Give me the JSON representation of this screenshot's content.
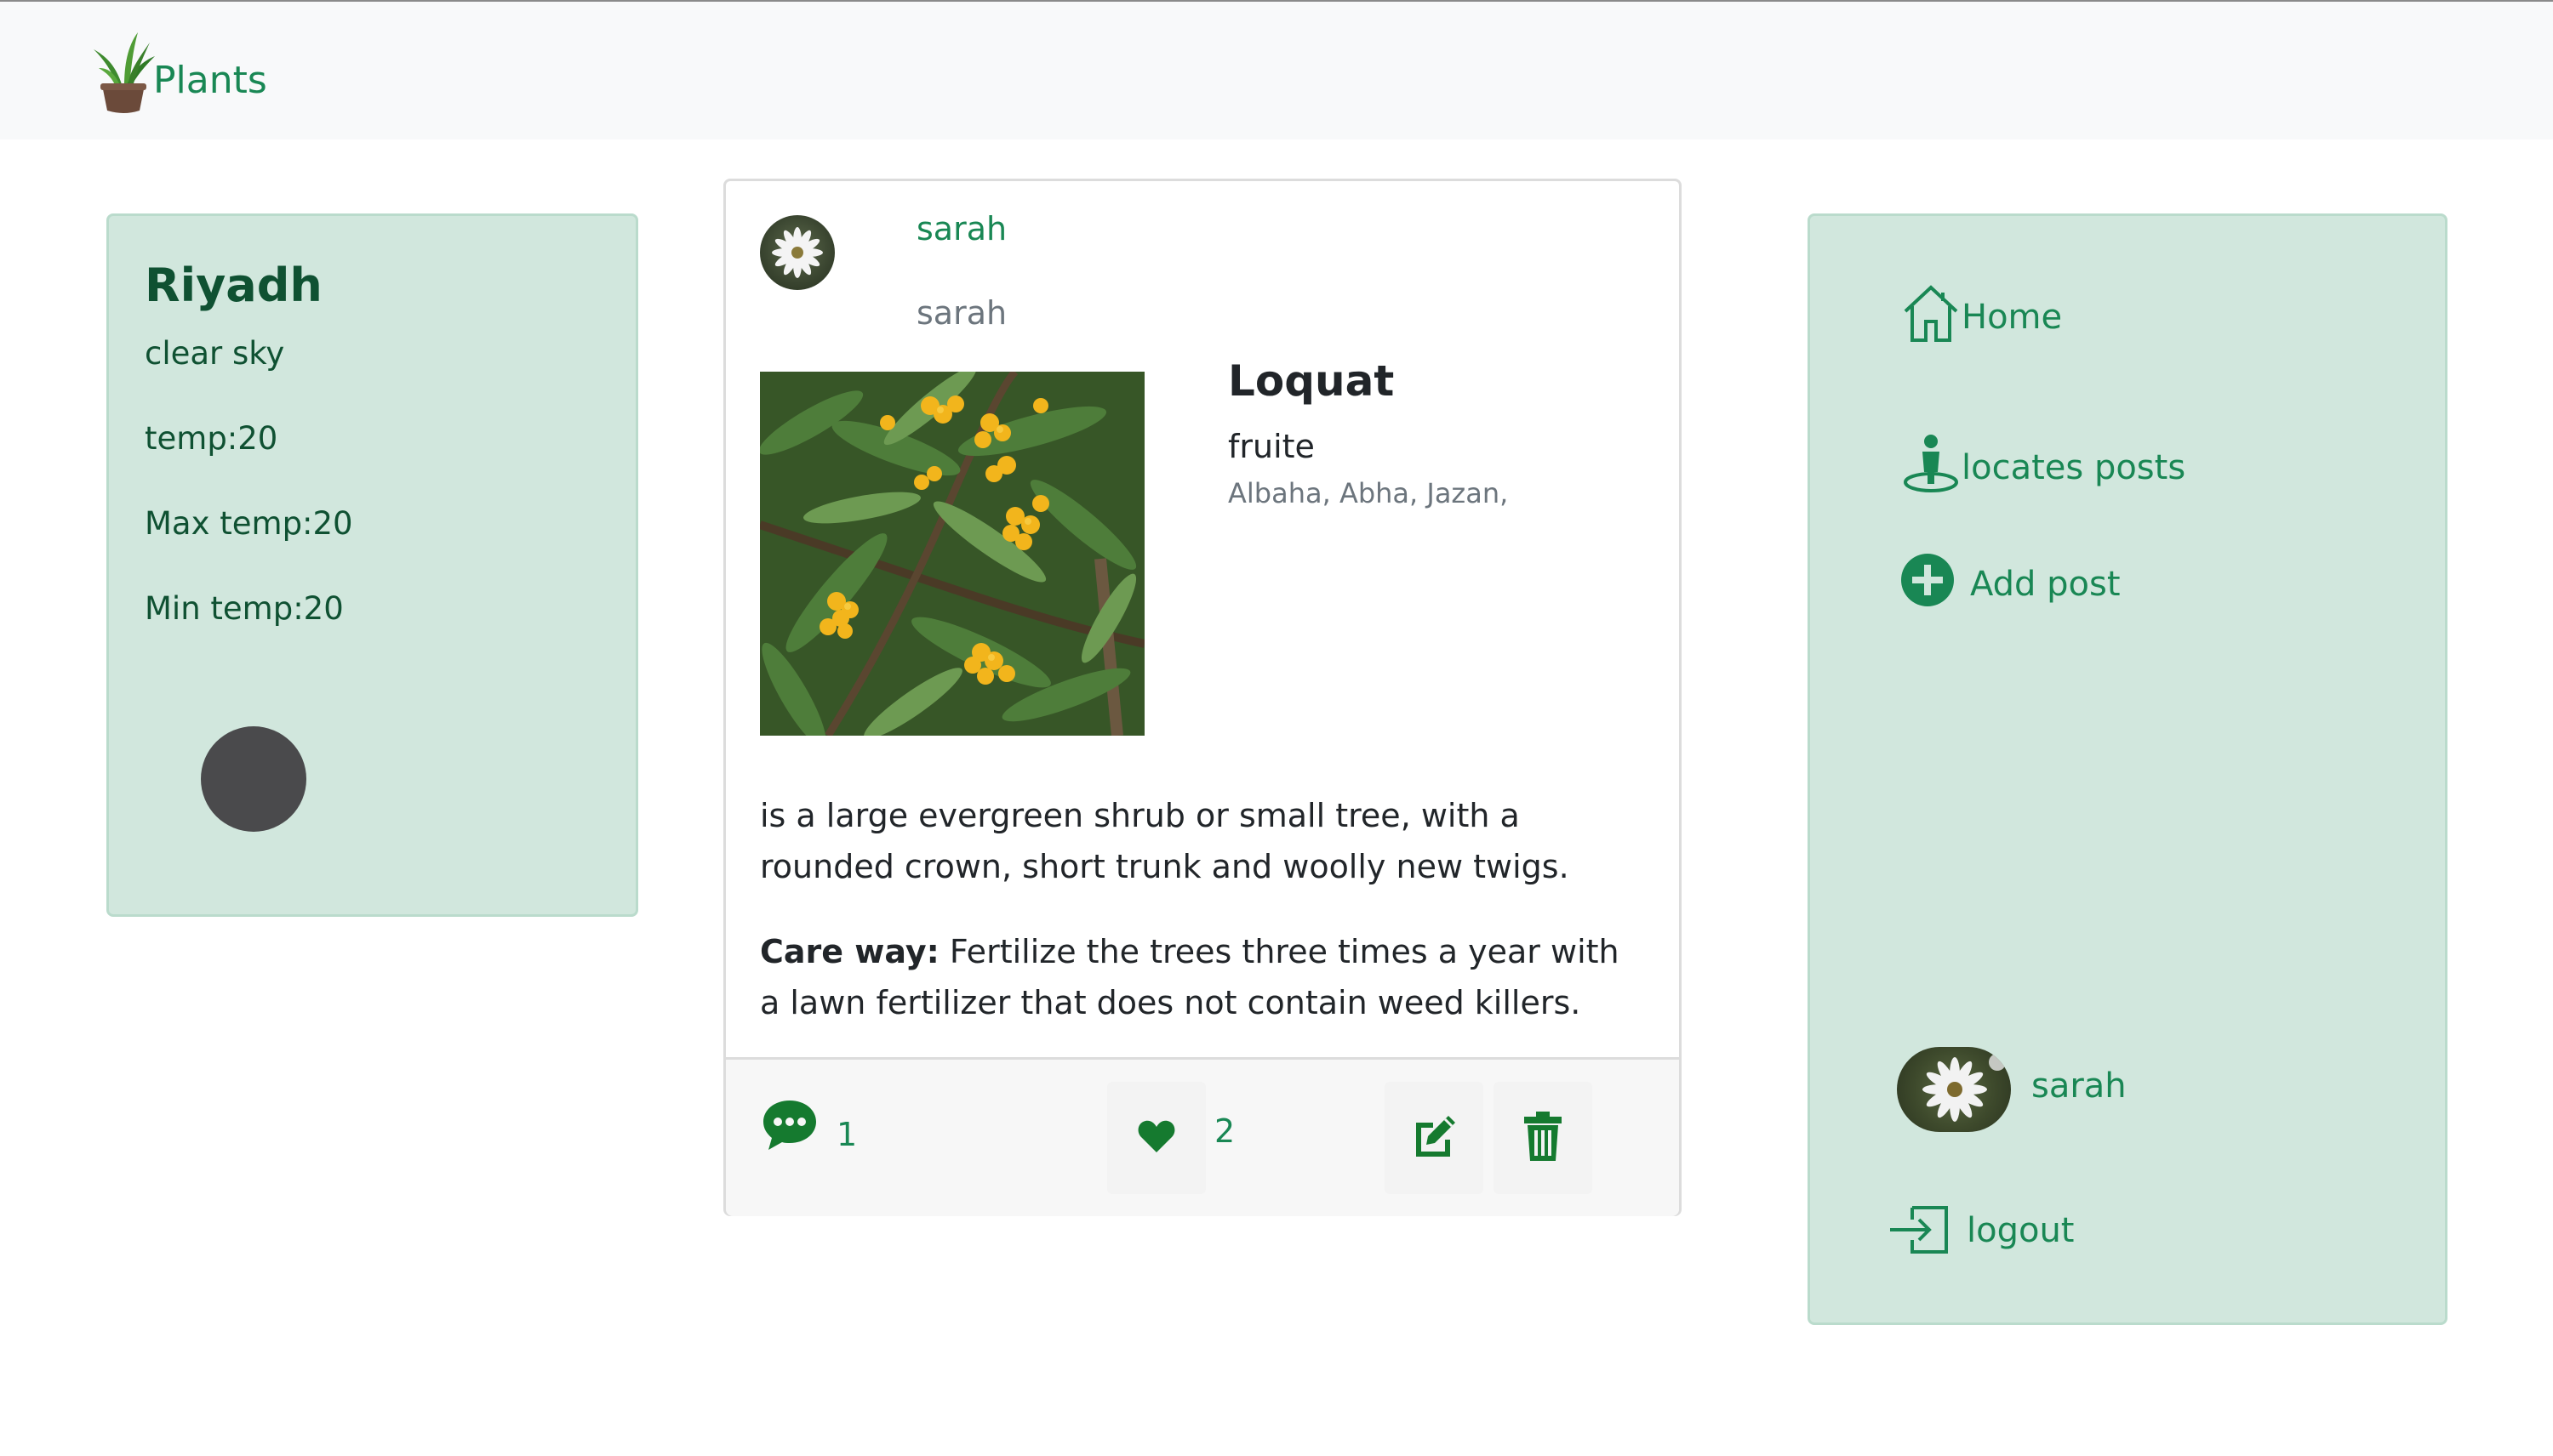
{
  "navbar": {
    "brand": "Plants"
  },
  "weather": {
    "city": "Riyadh",
    "description": "clear sky",
    "temp": "temp:20",
    "max_temp": "Max temp:20",
    "min_temp": "Min temp:20"
  },
  "post": {
    "username": "sarah",
    "subname": "sarah",
    "plant_name": "Loquat",
    "plant_type": "fruite",
    "regions": "Albaha, Abha, Jazan,",
    "description": "is a large evergreen shrub or small tree, with a rounded crown, short trunk and woolly new twigs.",
    "care_label": "Care way:",
    "care_text": " Fertilize the trees three times a year with a lawn fertilizer that does not contain weed killers.",
    "comments_count": "1",
    "likes_count": "2"
  },
  "sidebar": {
    "home": "Home",
    "locates_posts": "locates posts",
    "add_post": "Add post",
    "username": "sarah",
    "logout": "logout"
  },
  "colors": {
    "accent": "#198754",
    "card_bg": "#d1e7dd",
    "card_border": "#badbcc",
    "icon_green": "#157a2f"
  },
  "icons": {
    "brand": "potted-plant-icon",
    "home": "house-icon",
    "locates": "map-pin-person-icon",
    "add": "plus-circle-icon",
    "logout": "box-arrow-in-icon",
    "comment": "chat-dots-icon",
    "like": "heart-icon",
    "edit": "pencil-square-icon",
    "delete": "trash-icon"
  }
}
